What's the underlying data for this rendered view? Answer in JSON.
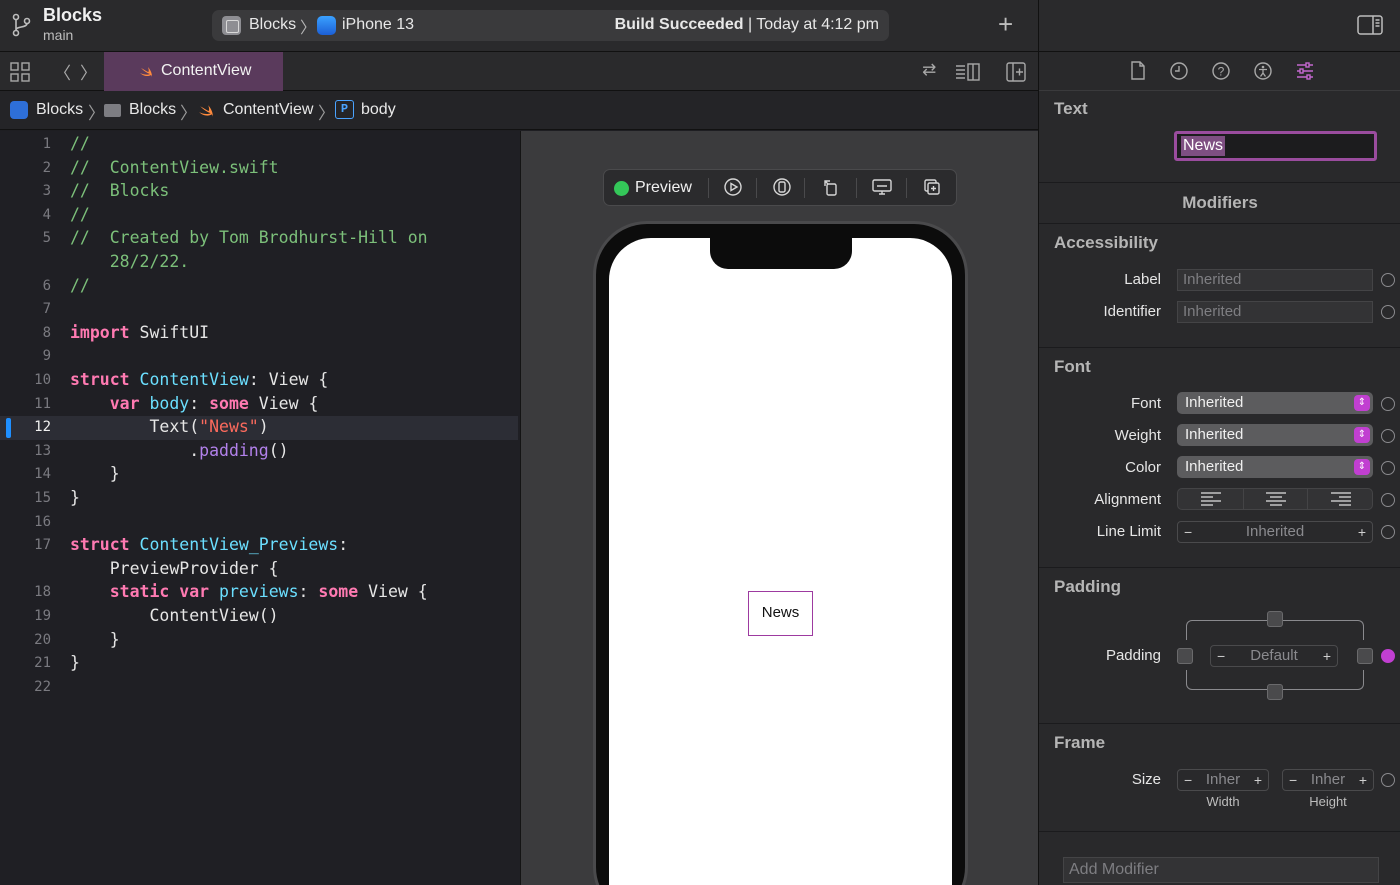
{
  "window": {
    "project_name": "Blocks",
    "branch": "main",
    "scheme": "Blocks",
    "device": "iPhone 13",
    "build_status_bold": "Build Succeeded",
    "build_status_rest": " | Today at 4:12 pm"
  },
  "tabs": [
    {
      "label": "ContentView",
      "active": true
    }
  ],
  "jumpbar": [
    "Blocks",
    "Blocks",
    "ContentView",
    "body"
  ],
  "editor": {
    "current_line": 12,
    "lines": [
      {
        "n": "1",
        "html": "<span class='cm'>//</span>"
      },
      {
        "n": "2",
        "html": "<span class='cm'>//  ContentView.swift</span>"
      },
      {
        "n": "3",
        "html": "<span class='cm'>//  Blocks</span>"
      },
      {
        "n": "4",
        "html": "<span class='cm'>//</span>"
      },
      {
        "n": "5",
        "html": "<span class='cm'>//  Created by Tom Brodhurst-Hill on</span>"
      },
      {
        "n": "",
        "html": "<span class='cm'>    28/2/22.</span>"
      },
      {
        "n": "6",
        "html": "<span class='cm'>//</span>"
      },
      {
        "n": "7",
        "html": ""
      },
      {
        "n": "8",
        "html": "<span class='kw'>import</span> SwiftUI"
      },
      {
        "n": "9",
        "html": ""
      },
      {
        "n": "10",
        "html": "<span class='kw'>struct</span> <span class='ty'>ContentView</span>: View {"
      },
      {
        "n": "11",
        "html": "    <span class='kw'>var</span> <span class='ty'>body</span>: <span class='kw'>some</span> View {"
      },
      {
        "n": "12",
        "html": "        Text(<span class='st'>\"News\"</span>)"
      },
      {
        "n": "13",
        "html": "            .<span class='md'>padding</span>()"
      },
      {
        "n": "14",
        "html": "    }"
      },
      {
        "n": "15",
        "html": "}"
      },
      {
        "n": "16",
        "html": ""
      },
      {
        "n": "17",
        "html": "<span class='kw'>struct</span> <span class='ty'>ContentView_Previews</span>:"
      },
      {
        "n": "",
        "html": "    PreviewProvider {"
      },
      {
        "n": "18",
        "html": "    <span class='kw'>static</span> <span class='kw'>var</span> <span class='ty'>previews</span>: <span class='kw'>some</span> View {"
      },
      {
        "n": "19",
        "html": "        ContentView()"
      },
      {
        "n": "20",
        "html": "    }"
      },
      {
        "n": "21",
        "html": "}"
      },
      {
        "n": "22",
        "html": ""
      }
    ]
  },
  "canvas": {
    "preview_label": "Preview",
    "preview_text": "News"
  },
  "inspector": {
    "text_section": "Text",
    "text_value": "News",
    "modifiers_title": "Modifiers",
    "accessibility": {
      "title": "Accessibility",
      "label_label": "Label",
      "label_placeholder": "Inherited",
      "identifier_label": "Identifier",
      "identifier_placeholder": "Inherited"
    },
    "font": {
      "title": "Font",
      "font_label": "Font",
      "font_value": "Inherited",
      "weight_label": "Weight",
      "weight_value": "Inherited",
      "color_label": "Color",
      "color_value": "Inherited",
      "alignment_label": "Alignment",
      "line_limit_label": "Line Limit",
      "line_limit_value": "Inherited"
    },
    "padding": {
      "title": "Padding",
      "label": "Padding",
      "value": "Default"
    },
    "frame": {
      "title": "Frame",
      "size_label": "Size",
      "width_value": "Inher",
      "width_caption": "Width",
      "height_value": "Inher",
      "height_caption": "Height"
    },
    "add_modifier_placeholder": "Add Modifier"
  },
  "colors": {
    "accent": "#c13fd1",
    "tab_active": "#5a3a5c",
    "preview_dot": "#34c759"
  }
}
